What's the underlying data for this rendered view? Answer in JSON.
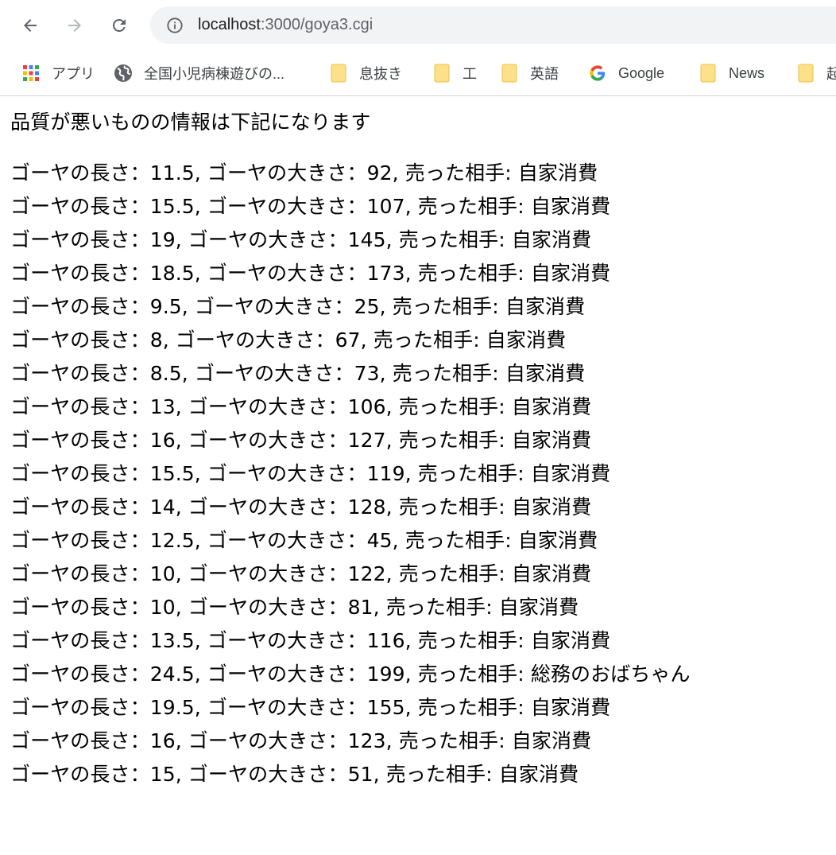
{
  "browser": {
    "url_host": "localhost",
    "url_rest": ":3000/goya3.cgi",
    "bookmarks": [
      {
        "label": "アプリ",
        "icon": "apps-grid-icon"
      },
      {
        "label": "全国小児病棟遊びの...",
        "icon": "globe-icon"
      },
      {
        "label": "息抜き",
        "icon": "folder-icon"
      },
      {
        "label": "工",
        "icon": "folder-icon"
      },
      {
        "label": "英語",
        "icon": "folder-icon"
      },
      {
        "label": "Google",
        "icon": "google-icon"
      },
      {
        "label": "News",
        "icon": "folder-icon"
      },
      {
        "label": "起",
        "icon": "folder-icon"
      }
    ]
  },
  "page": {
    "heading": "品質が悪いものの情報は下記になります",
    "rows": [
      "ゴーヤの長さ：11.5, ゴーヤの大きさ：92, 売った相手: 自家消費",
      "ゴーヤの長さ：15.5, ゴーヤの大きさ：107, 売った相手: 自家消費",
      "ゴーヤの長さ：19, ゴーヤの大きさ：145, 売った相手: 自家消費",
      "ゴーヤの長さ：18.5, ゴーヤの大きさ：173, 売った相手: 自家消費",
      "ゴーヤの長さ：9.5, ゴーヤの大きさ：25, 売った相手: 自家消費",
      "ゴーヤの長さ：8, ゴーヤの大きさ：67, 売った相手: 自家消費",
      "ゴーヤの長さ：8.5, ゴーヤの大きさ：73, 売った相手: 自家消費",
      "ゴーヤの長さ：13, ゴーヤの大きさ：106, 売った相手: 自家消費",
      "ゴーヤの長さ：16, ゴーヤの大きさ：127, 売った相手: 自家消費",
      "ゴーヤの長さ：15.5, ゴーヤの大きさ：119, 売った相手: 自家消費",
      "ゴーヤの長さ：14, ゴーヤの大きさ：128, 売った相手: 自家消費",
      "ゴーヤの長さ：12.5, ゴーヤの大きさ：45, 売った相手: 自家消費",
      "ゴーヤの長さ：10, ゴーヤの大きさ：122, 売った相手: 自家消費",
      "ゴーヤの長さ：10, ゴーヤの大きさ：81, 売った相手: 自家消費",
      "ゴーヤの長さ：13.5, ゴーヤの大きさ：116, 売った相手: 自家消費",
      "ゴーヤの長さ：24.5, ゴーヤの大きさ：199, 売った相手: 総務のおばちゃん",
      "ゴーヤの長さ：19.5, ゴーヤの大きさ：155, 売った相手: 自家消費",
      "ゴーヤの長さ：16, ゴーヤの大きさ：123, 売った相手: 自家消費",
      "ゴーヤの長さ：15, ゴーヤの大きさ：51, 売った相手: 自家消費"
    ]
  }
}
